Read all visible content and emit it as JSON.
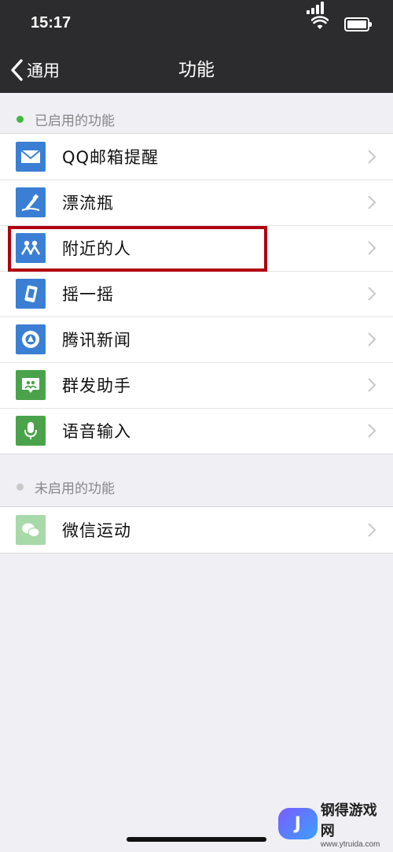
{
  "status": {
    "time": "15:17"
  },
  "nav": {
    "back_label": "通用",
    "title": "功能"
  },
  "enabled_section": {
    "label": "已启用的功能",
    "dot_color": "#3fba3f",
    "items": [
      {
        "label": "QQ邮箱提醒",
        "icon": "mail-icon",
        "color": "#3b7fd4"
      },
      {
        "label": "漂流瓶",
        "icon": "drift-bottle-icon",
        "color": "#3b7fd4"
      },
      {
        "label": "附近的人",
        "icon": "people-nearby-icon",
        "color": "#3b7fd4"
      },
      {
        "label": "摇一摇",
        "icon": "shake-icon",
        "color": "#3b7fd4"
      },
      {
        "label": "腾讯新闻",
        "icon": "news-icon",
        "color": "#3b7fd4"
      },
      {
        "label": "群发助手",
        "icon": "broadcast-icon",
        "color": "#4aa34a"
      },
      {
        "label": "语音输入",
        "icon": "microphone-icon",
        "color": "#4aa34a"
      }
    ]
  },
  "disabled_section": {
    "label": "未启用的功能",
    "dot_color": "#c8c8c8",
    "items": [
      {
        "label": "微信运动",
        "icon": "wechat-sport-icon",
        "color": "#a8d9a8"
      }
    ]
  },
  "watermark": {
    "logo_text": "J",
    "name": "钢得游戏网",
    "url": "www.ytruida.com"
  }
}
